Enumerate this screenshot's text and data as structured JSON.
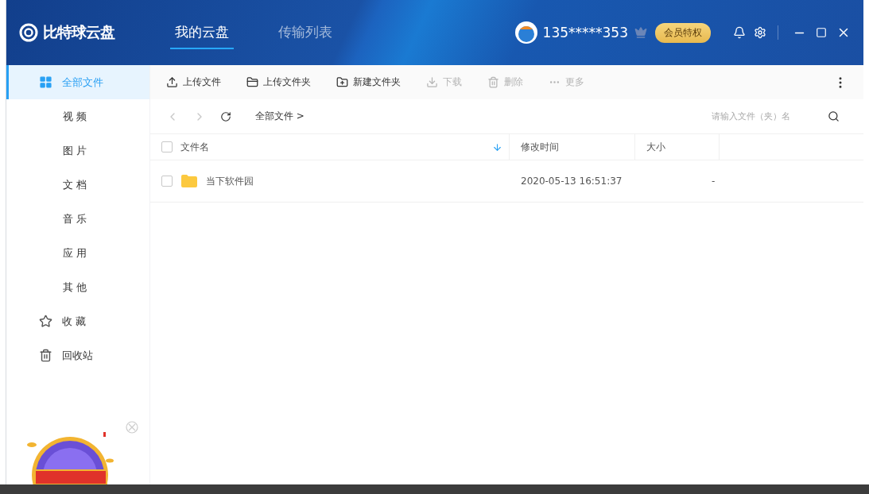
{
  "app": {
    "name": "比特球云盘"
  },
  "nav_tabs": [
    {
      "label": "我的云盘",
      "selected": true
    },
    {
      "label": "传输列表",
      "selected": false
    }
  ],
  "user": {
    "phone": "135*****353",
    "vip_button": "会员特权"
  },
  "sidebar": {
    "items": [
      {
        "label": "全部文件",
        "kind": "grid",
        "selected": true
      },
      {
        "label": "视 频",
        "kind": "plain",
        "selected": false
      },
      {
        "label": "图 片",
        "kind": "plain",
        "selected": false
      },
      {
        "label": "文 档",
        "kind": "plain",
        "selected": false
      },
      {
        "label": "音 乐",
        "kind": "plain",
        "selected": false
      },
      {
        "label": "应 用",
        "kind": "plain",
        "selected": false
      },
      {
        "label": "其 他",
        "kind": "plain",
        "selected": false
      },
      {
        "label": "收 藏",
        "kind": "star",
        "selected": false
      },
      {
        "label": "回收站",
        "kind": "trash",
        "selected": false
      }
    ]
  },
  "toolbar": [
    {
      "label": "上传文件",
      "kind": "upload",
      "disabled": false
    },
    {
      "label": "上传文件夹",
      "kind": "folder",
      "disabled": false
    },
    {
      "label": "新建文件夹",
      "kind": "newfolder",
      "disabled": false
    },
    {
      "label": "下载",
      "kind": "download",
      "disabled": true
    },
    {
      "label": "删除",
      "kind": "delete",
      "disabled": true
    },
    {
      "label": "更多",
      "kind": "more",
      "disabled": true
    }
  ],
  "path": {
    "breadcrumb": "全部文件 >",
    "search_placeholder": "请输入文件（夹）名"
  },
  "table": {
    "select_all_checked": false,
    "columns": [
      "文件名",
      "修改时间",
      "大小"
    ],
    "rows": [
      {
        "name": "当下软件园",
        "modified": "2020-05-13 16:51:37",
        "size": "-",
        "checked": false
      }
    ]
  }
}
